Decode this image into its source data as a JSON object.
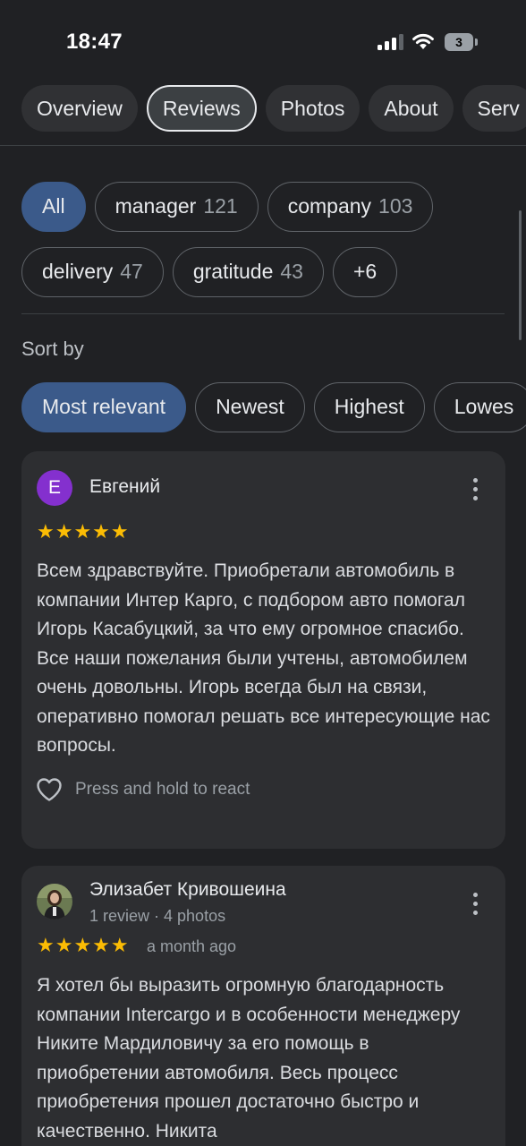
{
  "status_bar": {
    "time": "18:47",
    "battery": "3",
    "icons": [
      "cellular-signal-icon",
      "wifi-icon",
      "battery-icon"
    ]
  },
  "tabs": [
    {
      "label": "Overview",
      "active": false
    },
    {
      "label": "Reviews",
      "active": true
    },
    {
      "label": "Photos",
      "active": false
    },
    {
      "label": "About",
      "active": false
    },
    {
      "label": "Serv",
      "active": false
    }
  ],
  "topics": {
    "row1": [
      {
        "label": "All",
        "count": "",
        "selected": true
      },
      {
        "label": "manager",
        "count": "121",
        "selected": false
      },
      {
        "label": "company",
        "count": "103",
        "selected": false
      }
    ],
    "row2": [
      {
        "label": "delivery",
        "count": "47",
        "selected": false
      },
      {
        "label": "gratitude",
        "count": "43",
        "selected": false
      },
      {
        "label": "+6",
        "count": "",
        "selected": false
      }
    ]
  },
  "sort": {
    "label": "Sort by",
    "options": [
      {
        "label": "Most relevant",
        "selected": true
      },
      {
        "label": "Newest",
        "selected": false
      },
      {
        "label": "Highest",
        "selected": false
      },
      {
        "label": "Lowes",
        "selected": false
      }
    ]
  },
  "reviews": [
    {
      "avatar_letter": "Е",
      "name": "Евгений",
      "meta": "",
      "stars": "★★★★★",
      "rating": 5,
      "date": "",
      "text": "Всем здравствуйте. Приобретали автомобиль в компании Интер Карго, с подбором авто помогал Игорь Касабуцкий, за что ему огромное спасибо. Все наши пожелания были учтены, автомобилем очень довольны. Игорь всегда был на связи, оперативно помогал решать все интересующие нас вопросы.",
      "react_label": "Press and hold to react"
    },
    {
      "avatar_letter": "",
      "name": "Элизабет Кривошеина",
      "meta": "1 review · 4 photos",
      "stars": "★★★★★",
      "rating": 5,
      "date": "a month ago",
      "text": "Я хотел бы выразить огромную благодарность компании Intercargo и в особенности менеджеру Никите Мардиловичу за его помощь в приобретении автомобиля. Весь процесс приобретения прошел достаточно быстро и качественно. Никита",
      "react_label": ""
    }
  ],
  "colors": {
    "background": "#202124",
    "card": "#2d2e31",
    "accent_selected": "#3b5a8a",
    "star": "#fbbc04",
    "avatar": "#8430ce"
  }
}
